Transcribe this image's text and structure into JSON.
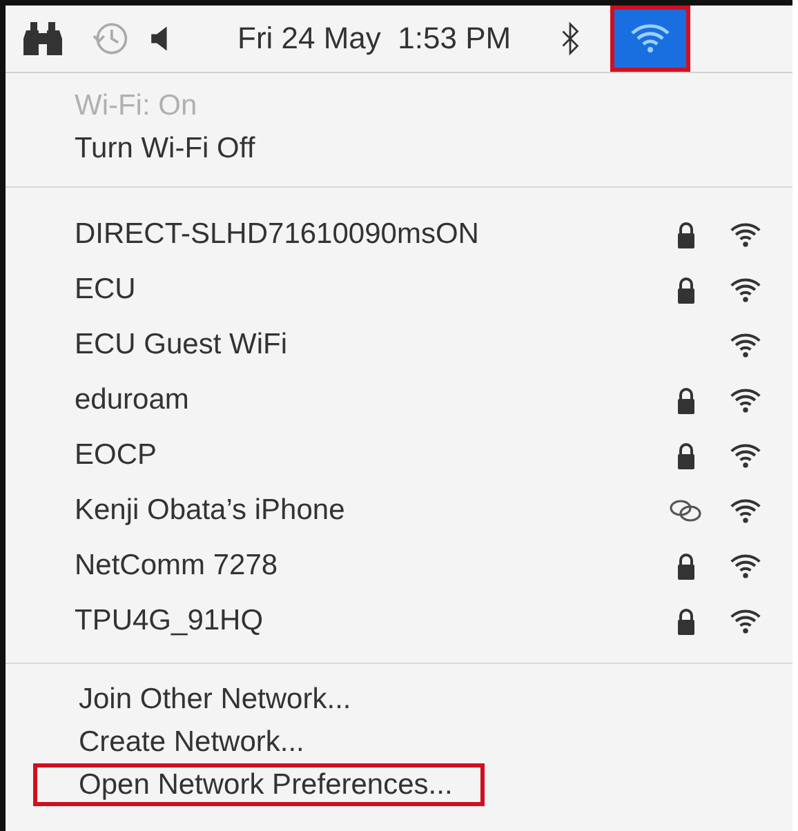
{
  "menu_bar": {
    "date_time": "Fri 24 May  1:53 PM",
    "wifi_highlighted": true
  },
  "status": {
    "label": "Wi-Fi: On",
    "disabled": true
  },
  "toggle": {
    "label": "Turn Wi-Fi Off"
  },
  "networks": [
    {
      "name": "DIRECT-SLHD71610090msON",
      "kind": "locked"
    },
    {
      "name": "ECU",
      "kind": "locked"
    },
    {
      "name": "ECU Guest WiFi",
      "kind": "open"
    },
    {
      "name": "eduroam",
      "kind": "locked"
    },
    {
      "name": "EOCP",
      "kind": "locked"
    },
    {
      "name": "Kenji Obata’s iPhone",
      "kind": "hotspot"
    },
    {
      "name": "NetComm 7278",
      "kind": "locked"
    },
    {
      "name": "TPU4G_91HQ",
      "kind": "locked"
    }
  ],
  "actions": [
    {
      "label": "Join Other Network...",
      "highlighted": false
    },
    {
      "label": "Create Network...",
      "highlighted": false
    },
    {
      "label": "Open Network Preferences...",
      "highlighted": true
    }
  ]
}
